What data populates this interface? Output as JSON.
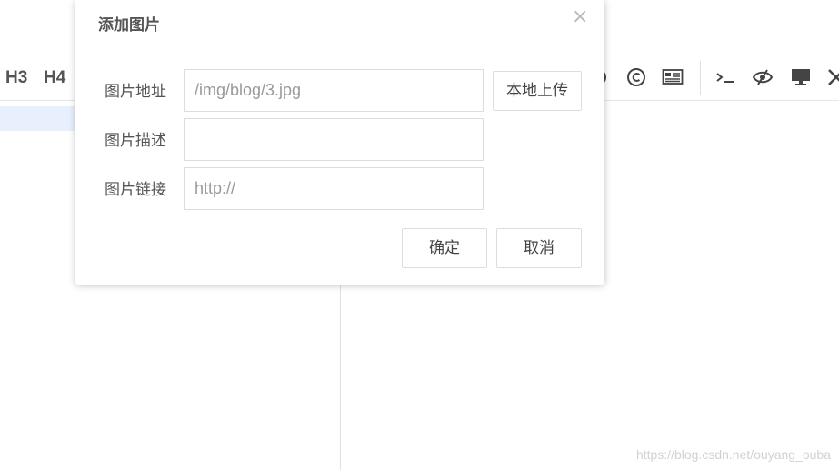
{
  "toolbar": {
    "h3": "H3",
    "h4": "H4"
  },
  "dialog": {
    "title": "添加图片",
    "close": "×",
    "fields": {
      "url_label": "图片地址",
      "url_value": "/img/blog/3.jpg",
      "desc_label": "图片描述",
      "desc_value": "",
      "link_label": "图片链接",
      "link_placeholder": "http://"
    },
    "upload_button": "本地上传",
    "confirm_button": "确定",
    "cancel_button": "取消"
  },
  "watermark": "https://blog.csdn.net/ouyang_ouba"
}
